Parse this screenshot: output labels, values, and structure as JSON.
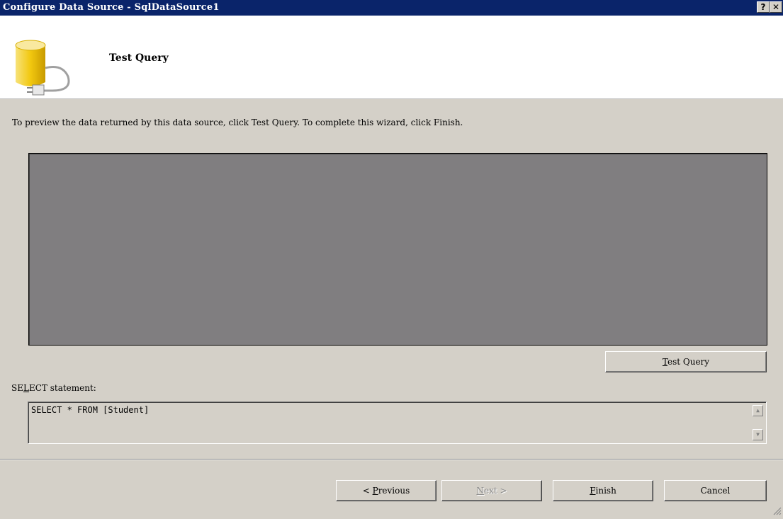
{
  "window": {
    "title": "Configure Data Source - SqlDataSource1",
    "help_label": "?",
    "close_label": "✕"
  },
  "header": {
    "heading": "Test Query"
  },
  "instruction": "To preview the data returned by this data source, click Test Query. To complete this wizard, click Finish.",
  "test_query_button": {
    "pre": "",
    "mnemonic": "T",
    "post": "est Query"
  },
  "select_statement": {
    "label_pre": "SE",
    "label_mnemonic": "L",
    "label_post": "ECT statement:",
    "value": "SELECT * FROM [Student]"
  },
  "footer": {
    "previous": {
      "pre": "< ",
      "mnemonic": "P",
      "post": "revious"
    },
    "next": {
      "pre": "",
      "mnemonic": "N",
      "post": "ext >"
    },
    "finish": {
      "pre": "",
      "mnemonic": "F",
      "post": "inish"
    },
    "cancel": {
      "label": "Cancel"
    }
  },
  "colors": {
    "titlebar": "#0a246a",
    "dialog_face": "#d4d0c8",
    "preview_area": "#807e80"
  },
  "icons": {
    "header": "database-plug-icon",
    "scroll_up": "scroll-up-icon",
    "scroll_down": "scroll-down-icon",
    "resize": "resize-grip-icon"
  }
}
